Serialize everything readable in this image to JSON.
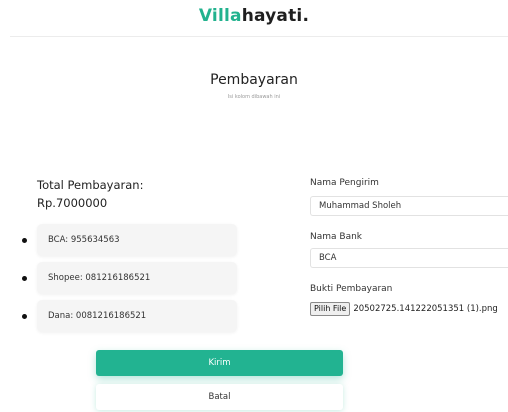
{
  "header": {
    "brand_accent": "Villa",
    "brand_rest": "hayati."
  },
  "page": {
    "title": "Pembayaran",
    "subtitle": "Isi kolom dibawah ini"
  },
  "summary": {
    "total_label": "Total Pembayaran:",
    "total_value": "Rp.7000000"
  },
  "payment_methods": [
    {
      "label": "BCA: 955634563"
    },
    {
      "label": "Shopee: 081216186521"
    },
    {
      "label": "Dana: 0081216186521"
    }
  ],
  "form": {
    "sender_label": "Nama Pengirim",
    "sender_value": "Muhammad Sholeh",
    "bank_label": "Nama Bank",
    "bank_value": "BCA",
    "proof_label": "Bukti Pembayaran",
    "file_button_label": "Pilih File",
    "file_name": "20502725.141222051351 (1).png"
  },
  "actions": {
    "submit_label": "Kirim",
    "cancel_label": "Batal"
  },
  "colors": {
    "accent": "#22b28e",
    "button_primary": "#22b391"
  }
}
